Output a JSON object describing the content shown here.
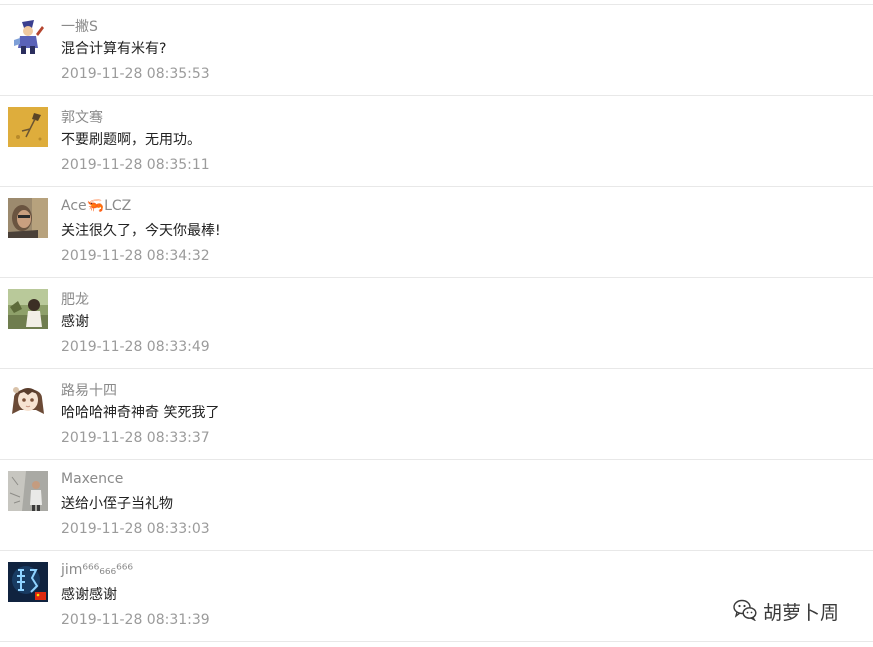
{
  "comments": [
    {
      "name": "一撇S",
      "content": "混合计算有米有?",
      "time": "2019-11-28 08:35:53",
      "avatar_icon": "cartoon-character-avatar"
    },
    {
      "name": "郭文骞",
      "content": "不要刷题啊，无用功。",
      "time": "2019-11-28 08:35:11",
      "avatar_icon": "yellow-sketch-avatar"
    },
    {
      "name": "Ace🦐LCZ",
      "content": "关注很久了，今天你最棒!",
      "time": "2019-11-28 08:34:32",
      "avatar_icon": "photo-man-avatar"
    },
    {
      "name": "肥龙",
      "content": "感谢",
      "time": "2019-11-28 08:33:49",
      "avatar_icon": "photo-outdoor-avatar"
    },
    {
      "name": "路易十四",
      "content": "哈哈哈神奇神奇 笑死我了",
      "time": "2019-11-28 08:33:37",
      "avatar_icon": "anime-girl-avatar"
    },
    {
      "name": "Maxence",
      "content": "送给小侄子当礼物",
      "time": "2019-11-28 08:33:03",
      "avatar_icon": "photo-person-wall-avatar"
    },
    {
      "name": "jim⁶⁶⁶₆₆₆⁶⁶⁶",
      "content": "感谢感谢",
      "time": "2019-11-28 08:31:39",
      "avatar_icon": "dark-glyph-avatar-with-flag"
    }
  ],
  "watermark": {
    "text": "胡萝卜周",
    "icon": "wechat-icon"
  }
}
